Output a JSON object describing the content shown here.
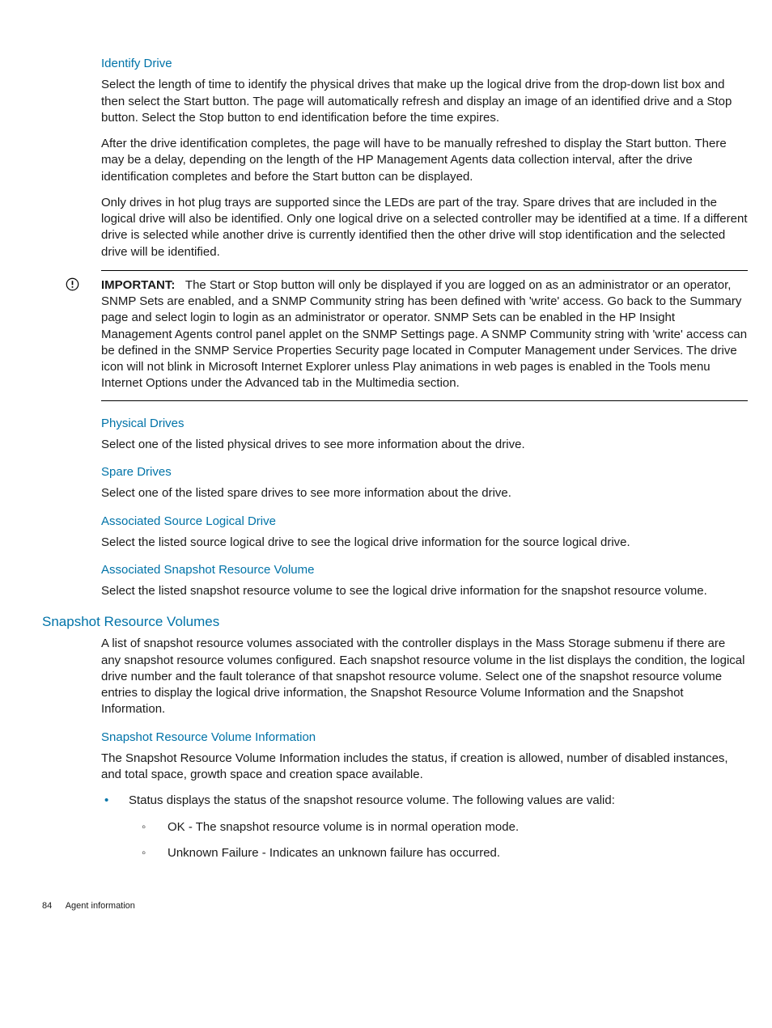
{
  "sections": {
    "identify_drive": {
      "heading": "Identify Drive",
      "p1": "Select the length of time to identify the physical drives that make up the logical drive from the drop-down list box and then select the Start button. The page will automatically refresh and display an image of an identified drive and a Stop button. Select the Stop button to end identification before the time expires.",
      "p2": "After the drive identification completes, the page will have to be manually refreshed to display the Start button. There may be a delay, depending on the length of the HP Management Agents data collection interval, after the drive identification completes and before the Start button can be displayed.",
      "p3": "Only drives in hot plug trays are supported since the LEDs are part of the tray. Spare drives that are included in the logical drive will also be identified. Only one logical drive on a selected controller may be identified at a time. If a different drive is selected while another drive is currently identified then the other drive will stop identification and the selected drive will be identified."
    },
    "important": {
      "label": "IMPORTANT:",
      "text": "The Start or Stop button will only be displayed if you are logged on as an administrator or an operator, SNMP Sets are enabled, and a SNMP Community string has been defined with 'write' access. Go back to the Summary page and select login to login as an administrator or operator. SNMP Sets can be enabled in the HP Insight Management Agents control panel applet on the SNMP Settings page. A SNMP Community string with 'write' access can be defined in the SNMP Service Properties Security page located in Computer Management under Services. The drive icon will not blink in Microsoft Internet Explorer unless Play animations in web pages is enabled in the Tools menu Internet Options under the Advanced tab in the Multimedia section."
    },
    "physical_drives": {
      "heading": "Physical Drives",
      "p1": "Select one of the listed physical drives to see more information about the drive."
    },
    "spare_drives": {
      "heading": "Spare Drives",
      "p1": "Select one of the listed spare drives to see more information about the drive."
    },
    "assoc_source": {
      "heading": "Associated Source Logical Drive",
      "p1": "Select the listed source logical drive to see the logical drive information for the source logical drive."
    },
    "assoc_snapshot": {
      "heading": "Associated Snapshot Resource Volume",
      "p1": "Select the listed snapshot resource volume to see the logical drive information for the snapshot resource volume."
    },
    "snapshot_volumes": {
      "heading": "Snapshot Resource Volumes",
      "p1": "A list of snapshot resource volumes associated with the controller displays in the Mass Storage submenu if there are any snapshot resource volumes configured. Each snapshot resource volume in the list displays the condition, the logical drive number and the fault tolerance of that snapshot resource volume. Select one of the snapshot resource volume entries to display the logical drive information, the Snapshot Resource Volume Information and the Snapshot Information."
    },
    "snapshot_info": {
      "heading": "Snapshot Resource Volume Information",
      "p1": "The Snapshot Resource Volume Information includes the status, if creation is allowed, number of disabled instances, and total space, growth space and creation space available.",
      "bullet1": "Status displays the status of the snapshot resource volume. The following values are valid:",
      "sub1": "OK - The snapshot resource volume is in normal operation mode.",
      "sub2": "Unknown Failure - Indicates an unknown failure has occurred."
    }
  },
  "footer": {
    "page": "84",
    "title": "Agent information"
  }
}
